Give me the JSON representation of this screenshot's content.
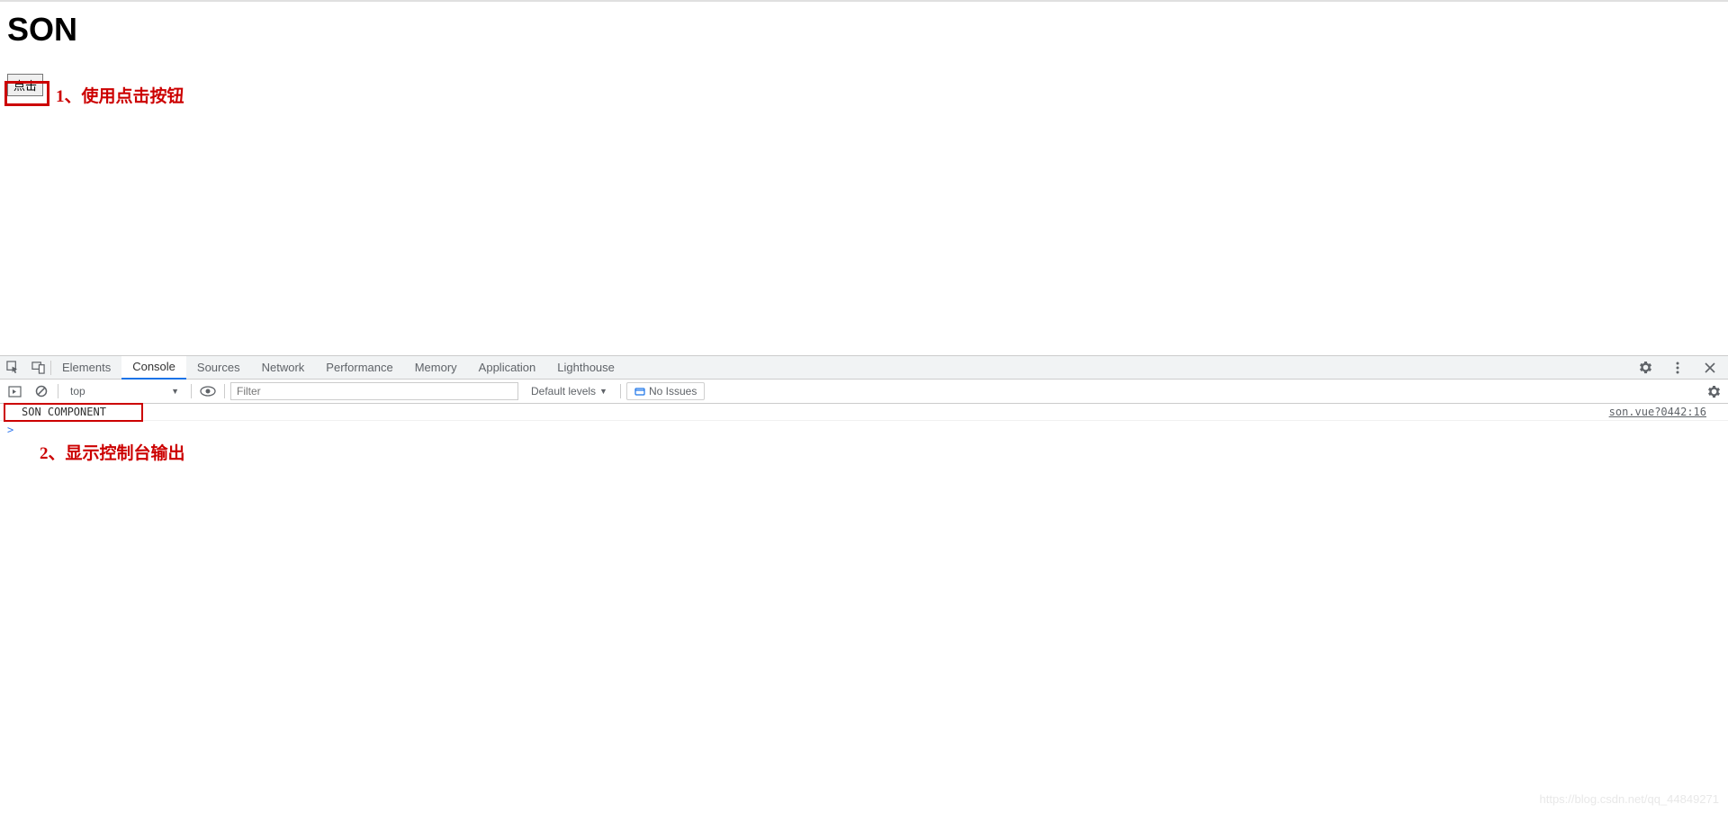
{
  "page": {
    "title": "SON",
    "button_label": "点击"
  },
  "annotations": {
    "a1": "1、使用点击按钮",
    "a2": "2、显示控制台输出"
  },
  "devtools": {
    "tabs": {
      "elements": "Elements",
      "console": "Console",
      "sources": "Sources",
      "network": "Network",
      "performance": "Performance",
      "memory": "Memory",
      "application": "Application",
      "lighthouse": "Lighthouse"
    },
    "toolbar": {
      "context": "top",
      "filter_placeholder": "Filter",
      "levels": "Default levels",
      "no_issues": "No Issues"
    },
    "console": {
      "log_message": "SON COMPONENT",
      "log_source": "son.vue?0442:16",
      "prompt": ">"
    }
  },
  "watermark": "https://blog.csdn.net/qq_44849271"
}
